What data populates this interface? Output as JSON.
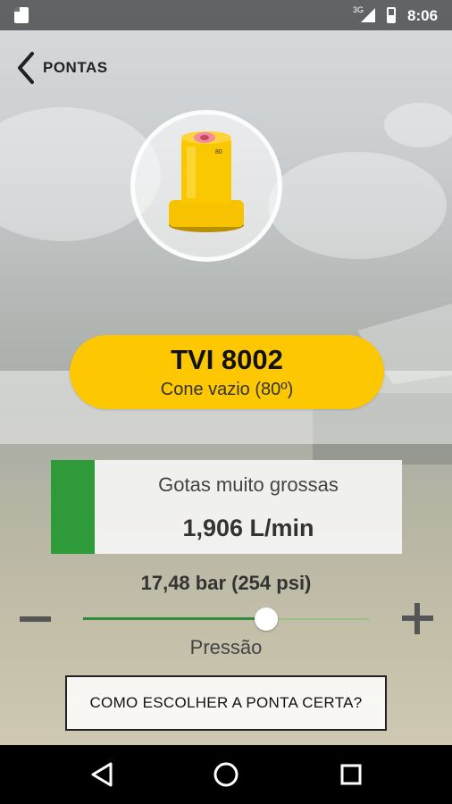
{
  "status_bar": {
    "network": "3G",
    "time": "8:06"
  },
  "header": {
    "back_label": "PONTAS"
  },
  "nozzle": {
    "code": "TVI 8002",
    "description": "Cone vazio (80º)",
    "color": "#fdc702",
    "label_on_tip": "80",
    "icons": {
      "tip": "nozzle-tip-image"
    }
  },
  "droplet": {
    "class": "Gotas muito grossas",
    "flow": "1,906 L/min",
    "class_color": "#2e9a3a"
  },
  "pressure": {
    "value": "17,48 bar (254 psi)",
    "label": "Pressão",
    "slider_fraction": 0.64
  },
  "actions": {
    "help_button": "COMO ESCOLHER A PONTA CERTA?"
  },
  "nav_bar": {
    "back_icon": "nav-back-icon",
    "home_icon": "nav-home-icon",
    "recents_icon": "nav-recents-icon"
  },
  "colors": {
    "accent": "#fdc702",
    "green": "#2e9a3a"
  }
}
